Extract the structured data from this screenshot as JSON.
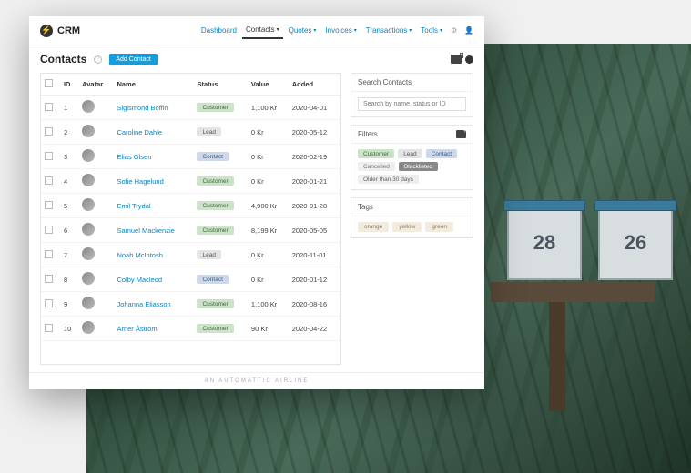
{
  "brand": "CRM",
  "nav": [
    "Dashboard",
    "Contacts",
    "Quotes",
    "Invoices",
    "Transactions",
    "Tools"
  ],
  "nav_active_index": 1,
  "page_title": "Contacts",
  "add_button": "Add Contact",
  "columns": [
    "ID",
    "Avatar",
    "Name",
    "Status",
    "Value",
    "Added"
  ],
  "footer": "AN AUTOMATTIC AIRLINE",
  "rows": [
    {
      "id": "1",
      "name": "Sigismond Boffin",
      "status": "Customer",
      "status_class": "customer",
      "value": "1,100 Kr",
      "added": "2020-04-01"
    },
    {
      "id": "2",
      "name": "Caroline Dahle",
      "status": "Lead",
      "status_class": "lead",
      "value": "0 Kr",
      "added": "2020-05-12"
    },
    {
      "id": "3",
      "name": "Elias Olsen",
      "status": "Contact",
      "status_class": "contact",
      "value": "0 Kr",
      "added": "2020-02-19"
    },
    {
      "id": "4",
      "name": "Sofie Hagelund",
      "status": "Customer",
      "status_class": "customer",
      "value": "0 Kr",
      "added": "2020-01-21"
    },
    {
      "id": "5",
      "name": "Emil Trydal",
      "status": "Customer",
      "status_class": "customer",
      "value": "4,900 Kr",
      "added": "2020-01-28"
    },
    {
      "id": "6",
      "name": "Samuel Mackenzie",
      "status": "Customer",
      "status_class": "customer",
      "value": "8,199 Kr",
      "added": "2020-05-05"
    },
    {
      "id": "7",
      "name": "Noah McIntosh",
      "status": "Lead",
      "status_class": "lead",
      "value": "0 Kr",
      "added": "2020-11-01"
    },
    {
      "id": "8",
      "name": "Colby Macleod",
      "status": "Contact",
      "status_class": "contact",
      "value": "0 Kr",
      "added": "2020-01-12"
    },
    {
      "id": "9",
      "name": "Johanna Eliasson",
      "status": "Customer",
      "status_class": "customer",
      "value": "1,100 Kr",
      "added": "2020-08-16"
    },
    {
      "id": "10",
      "name": "Arner Åström",
      "status": "Customer",
      "status_class": "customer",
      "value": "90 Kr",
      "added": "2020-04-22"
    }
  ],
  "side": {
    "search_title": "Search Contacts",
    "search_placeholder": "Search by name, status or ID",
    "filters_title": "Filters",
    "filters": [
      {
        "label": "Customer",
        "class": "customer"
      },
      {
        "label": "Lead",
        "class": "lead"
      },
      {
        "label": "Contact",
        "class": "contact"
      },
      {
        "label": "Cancelled",
        "class": "cancelled"
      },
      {
        "label": "Blacklisted",
        "class": "blacklisted"
      },
      {
        "label": "Older than 30 days",
        "class": "older"
      }
    ],
    "tags_title": "Tags",
    "tags": [
      "orange",
      "yellow",
      "green"
    ]
  },
  "mailboxes": [
    "28",
    "26"
  ]
}
